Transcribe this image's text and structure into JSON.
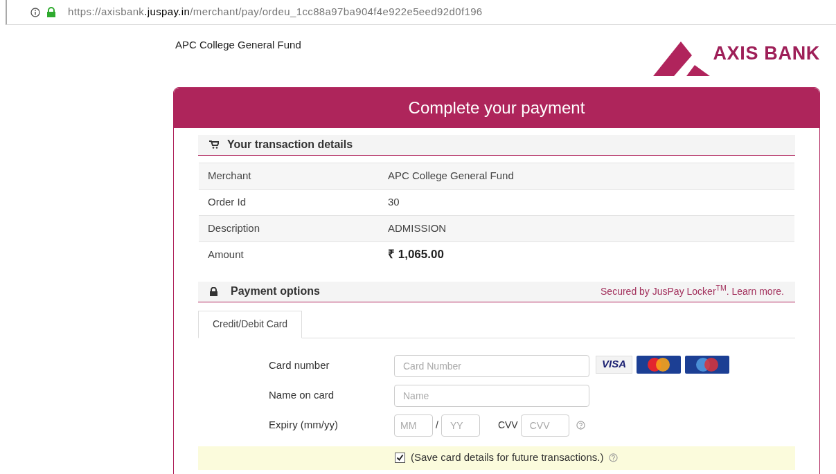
{
  "address_bar": {
    "url": "https://axisbank**.juspay.in**/merchant/pay/ordeu_1cc88a97ba904f4e922e5eed92d0f196",
    "secure": true
  },
  "merchant_name": "APC College General Fund",
  "logo": {
    "text": "AXIS BANK"
  },
  "card": {
    "title": "Complete your payment"
  },
  "transaction": {
    "heading": "Your transaction details",
    "rows": [
      {
        "label": "Merchant",
        "value": "APC College General Fund",
        "kind": "plain"
      },
      {
        "label": "Order Id",
        "value": "30",
        "kind": "plain"
      },
      {
        "label": "Description",
        "value": "ADMISSION",
        "kind": "plain"
      },
      {
        "label": "Amount",
        "value": "₹ 1,065.00",
        "kind": "amount"
      }
    ]
  },
  "payment": {
    "heading": "Payment options",
    "secured_note": "Secured by JusPay Locker$^{TM}$. Learn more.",
    "tabs": [
      {
        "label": "Credit/Debit Card",
        "selected": true
      }
    ],
    "card_number": {
      "label": "Card number",
      "placeholder": "Card Number"
    },
    "card_brands": [
      {
        "kind": "visa",
        "text": "VISA"
      },
      {
        "kind": "mastercard"
      },
      {
        "kind": "maestro"
      }
    ],
    "name": {
      "label": "Name on card",
      "placeholder": "Name"
    },
    "expiry": {
      "label": "Expiry (mm/yy)",
      "month_placeholder": "MM",
      "separator": "/",
      "year_placeholder": "YY"
    },
    "cvv": {
      "label": "CVV",
      "placeholder": "CVV"
    },
    "save_card": {
      "label": "(Save card details for future transactions.)",
      "checked": true
    }
  }
}
